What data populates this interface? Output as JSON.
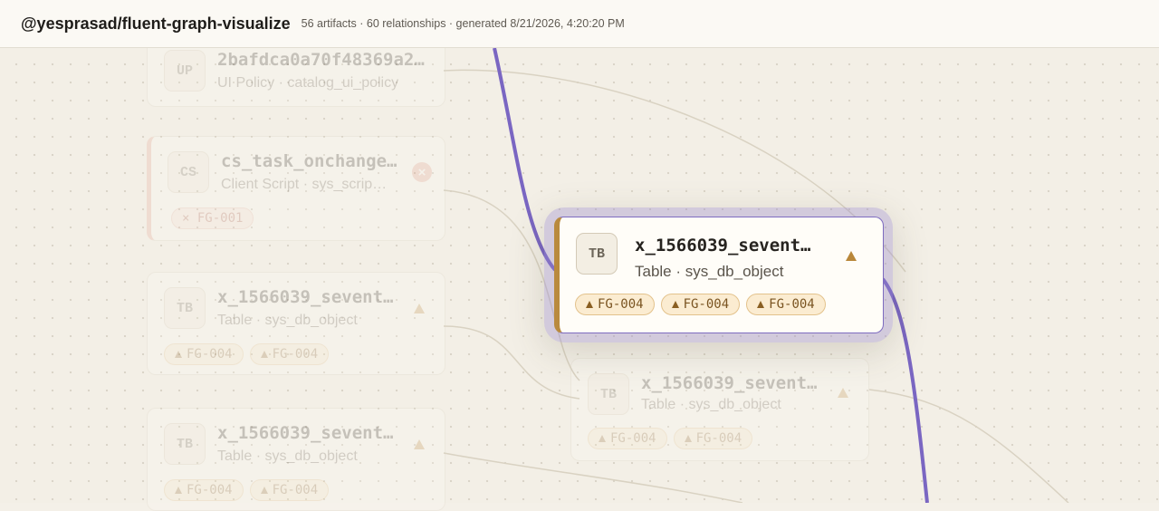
{
  "header": {
    "title": "@yesprasad/fluent-graph-visualize",
    "meta": "56 artifacts · 60 relationships · generated 8/21/2026, 4:20:20 PM"
  },
  "colors": {
    "edge": "#7a66c2",
    "accent": "#b98a3e",
    "warning": "#b9873a",
    "error": "#e59a88"
  },
  "faded_nodes": [
    {
      "abbr": "UP",
      "name": "2bafdca0a70f48369a2…",
      "sub": "UI Policy · catalog_ui_policy",
      "chips": []
    },
    {
      "abbr": "CS",
      "name": "cs_task_onchange…",
      "sub": "Client Script · sys_scrip…",
      "status_icon": "close-icon",
      "chips": [
        "× FG-001"
      ]
    },
    {
      "abbr": "TB",
      "name": "x_1566039_sevent…",
      "sub": "Table · sys_db_object",
      "status_icon": "warning-icon",
      "chips": [
        "FG-004",
        "FG-004"
      ]
    },
    {
      "abbr": "TB",
      "name": "x_1566039_sevent…",
      "sub": "Table · sys_db_object",
      "status_icon": "warning-icon",
      "chips": [
        "FG-004",
        "FG-004"
      ]
    },
    {
      "abbr": "TB",
      "name": "x_1566039_sevent…",
      "sub": "Table · sys_db_object",
      "status_icon": "warning-icon",
      "chips": [
        "FG-004",
        "FG-004"
      ]
    }
  ],
  "focused_node": {
    "abbr": "TB",
    "name": "x_1566039_sevent…",
    "sub": "Table · sys_db_object",
    "status_icon": "warning-icon",
    "chips": [
      "FG-004",
      "FG-004",
      "FG-004"
    ]
  }
}
